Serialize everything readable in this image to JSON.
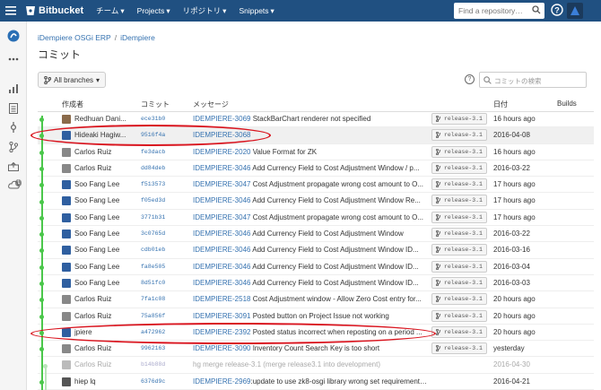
{
  "topbar": {
    "brand": "Bitbucket",
    "nav": [
      "チーム",
      "Projects",
      "リポジトリ",
      "Snippets"
    ],
    "search_placeholder": "Find a repository…"
  },
  "breadcrumb": [
    "iDempiere OSGi ERP",
    "iDempiere"
  ],
  "page_title": "コミット",
  "branch_button": "All branches",
  "commit_search_placeholder": "コミットの検索",
  "sidebar_badge": "1",
  "columns": {
    "author": "作成者",
    "commit": "コミット",
    "message": "メッセージ",
    "date": "日付",
    "builds": "Builds"
  },
  "commits": [
    {
      "author": "Redhuan Dani...",
      "hash": "ece31b0",
      "issue": "IDEMPIERE-3069",
      "text": " StackBarChart renderer not specified",
      "tag": "release-3.1",
      "date": "16 hours ago",
      "avatar": "#8a6a4a"
    },
    {
      "author": "Hideaki Hagiw...",
      "hash": "9516f4a",
      "issue": "IDEMPIERE-3068",
      "text": "",
      "tag": "release-3.1",
      "date": "2016-04-08",
      "avatar": "#2f5fa0"
    },
    {
      "author": "Carlos Ruiz",
      "hash": "fe3dacb",
      "issue": "IDEMPIERE-2020",
      "text": " Value Format for ZK",
      "tag": "release-3.1",
      "date": "16 hours ago",
      "avatar": "#888888"
    },
    {
      "author": "Carlos Ruiz",
      "hash": "dd84deb",
      "issue": "IDEMPIERE-3046",
      "text": " Add Currency Field to Cost Adjustment Window / p...",
      "tag": "release-3.1",
      "date": "2016-03-22",
      "avatar": "#888888"
    },
    {
      "author": "Soo Fang Lee",
      "hash": "f513573",
      "issue": "IDEMPIERE-3047",
      "text": " Cost Adjustment propagate wrong cost amount to O...",
      "tag": "release-3.1",
      "date": "17 hours ago",
      "avatar": "#2f5fa0"
    },
    {
      "author": "Soo Fang Lee",
      "hash": "f05ed3d",
      "issue": "IDEMPIERE-3046",
      "text": " Add Currency Field to Cost Adjustment Window Re...",
      "tag": "release-3.1",
      "date": "17 hours ago",
      "avatar": "#2f5fa0"
    },
    {
      "author": "Soo Fang Lee",
      "hash": "3771b31",
      "issue": "IDEMPIERE-3047",
      "text": " Cost Adjustment propagate wrong cost amount to O...",
      "tag": "release-3.1",
      "date": "17 hours ago",
      "avatar": "#2f5fa0"
    },
    {
      "author": "Soo Fang Lee",
      "hash": "3c0765d",
      "issue": "IDEMPIERE-3046",
      "text": " Add Currency Field to Cost Adjustment Window",
      "tag": "release-3.1",
      "date": "2016-03-22",
      "avatar": "#2f5fa0"
    },
    {
      "author": "Soo Fang Lee",
      "hash": "cdb01eb",
      "issue": "IDEMPIERE-3046",
      "text": " Add Currency Field to Cost Adjustment Window ID...",
      "tag": "release-3.1",
      "date": "2016-03-16",
      "avatar": "#2f5fa0"
    },
    {
      "author": "Soo Fang Lee",
      "hash": "fa8e505",
      "issue": "IDEMPIERE-3046",
      "text": " Add Currency Field to Cost Adjustment Window ID...",
      "tag": "release-3.1",
      "date": "2016-03-04",
      "avatar": "#2f5fa0"
    },
    {
      "author": "Soo Fang Lee",
      "hash": "8d51fc0",
      "issue": "IDEMPIERE-3046",
      "text": " Add Currency Field to Cost Adjustment Window ID...",
      "tag": "release-3.1",
      "date": "2016-03-03",
      "avatar": "#2f5fa0"
    },
    {
      "author": "Carlos Ruiz",
      "hash": "7fa1c08",
      "issue": "IDEMPIERE-2518",
      "text": " Cost Adjustment window - Allow Zero Cost entry for...",
      "tag": "release-3.1",
      "date": "20 hours ago",
      "avatar": "#888888"
    },
    {
      "author": "Carlos Ruiz",
      "hash": "75a856f",
      "issue": "IDEMPIERE-3091",
      "text": " Posted button on Project Issue not working",
      "tag": "release-3.1",
      "date": "20 hours ago",
      "avatar": "#888888"
    },
    {
      "author": "jpiere",
      "hash": "a472962",
      "issue": "IDEMPIERE-2392",
      "text": " Posted status incorrect when reposting on a period ...",
      "tag": "release-3.1",
      "date": "20 hours ago",
      "avatar": "#2f5fa0"
    },
    {
      "author": "Carlos Ruiz",
      "hash": "9962163",
      "issue": "IDEMPIERE-3090",
      "text": " Inventory Count Search Key is too short",
      "tag": "release-3.1",
      "date": "yesterday",
      "avatar": "#888888"
    },
    {
      "author": "Carlos Ruiz",
      "hash": "b14b88d",
      "issue": "",
      "text": "hg merge release-3.1 (merge release3.1 into development)",
      "tag": "",
      "date": "2016-04-30",
      "avatar": "#bbbbbb",
      "dimmed": true
    },
    {
      "author": "hiep lq",
      "hash": "6376d9c",
      "issue": "IDEMPIERE-2969",
      "text": ":update to use zk8-osgi library wrong set requirement env",
      "tag": "",
      "date": "2016-04-21",
      "avatar": "#555555"
    }
  ]
}
